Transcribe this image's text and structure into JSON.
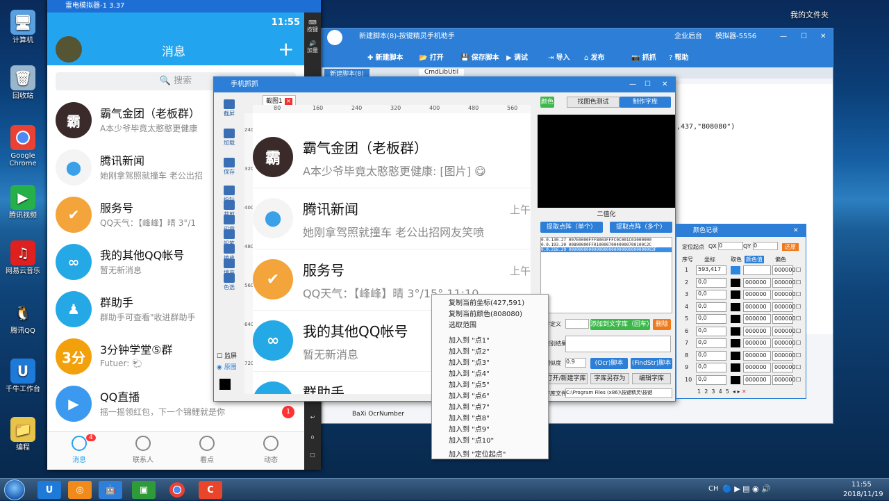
{
  "desktop": {
    "icons": [
      "计算机",
      "回收站",
      "Google Chrome",
      "腾讯视频",
      "网易云音乐",
      "腾讯QQ",
      "千牛工作台",
      "编程"
    ],
    "folder_label": "我的文件夹"
  },
  "emulator": {
    "title": "雷电模拟器-1 3.37",
    "time": "11:55",
    "header_title": "消息",
    "search_placeholder": "搜索",
    "side_labels": [
      "按键",
      "加量"
    ],
    "chats": [
      {
        "name": "霸气金团（老板群）",
        "preview": "A本少爷毕竟太憨憨更健康",
        "color": "#3a2a2a",
        "glyph": "霸"
      },
      {
        "name": "腾讯新闻",
        "preview": "她刚拿驾照就撞车 老公出招",
        "color": "#f4f4f4",
        "glyph": "⬤"
      },
      {
        "name": "服务号",
        "preview": "QQ天气：【峰峰】晴 3°/1",
        "color": "#f3a43a",
        "glyph": "✔"
      },
      {
        "name": "我的其他QQ帐号",
        "preview": "暂无新消息",
        "color": "#24a9e6",
        "glyph": "∞"
      },
      {
        "name": "群助手",
        "preview": "群助手可查看\"收进群助手",
        "color": "#24a9e6",
        "glyph": "♟"
      },
      {
        "name": "3分钟学堂⑤群",
        "preview": "Futuer: 🐑",
        "color": "#f2a10c",
        "glyph": "3分"
      },
      {
        "name": "QQ直播",
        "preview": "摇一摇领红包，下一个锦鲤就是你",
        "color": "#3b9af0",
        "glyph": "▶"
      }
    ],
    "live_badge": "1",
    "nav": [
      {
        "label": "消息",
        "badge": "4"
      },
      {
        "label": "联系人"
      },
      {
        "label": "看点"
      },
      {
        "label": "动态"
      }
    ]
  },
  "helper": {
    "title": "新建脚本(8)-按键精灵手机助手",
    "enterprise": "企业后台",
    "simulator": "模拟器-5556",
    "toolbar": [
      "新建脚本",
      "打开",
      "保存脚本",
      "调试",
      "导入",
      "发布",
      "抓抓",
      "帮助"
    ],
    "tabs": [
      "新建脚本(8)",
      "CmdLibUtil"
    ],
    "code_line": ",437,\"808080\")",
    "ocr": "BaXi OcrNumber"
  },
  "capture": {
    "title": "手机抓抓",
    "tab": "截图1",
    "tools": [
      "截屏",
      "加载",
      "保存",
      "指针",
      "裁剪",
      "印章",
      "铅笔",
      "擦皮",
      "填充",
      "色选"
    ],
    "ruler_top": [
      "80",
      "160",
      "240",
      "320",
      "400",
      "480",
      "560"
    ],
    "ruler_left": [
      "240",
      "320",
      "400",
      "480",
      "560",
      "640",
      "720"
    ],
    "chats": [
      {
        "name": "霸气金团（老板群）",
        "preview": "A本少爷毕竟太憨憨更健康: [图片] 😋",
        "time": "",
        "color": "#3a2a2a",
        "glyph": "霸"
      },
      {
        "name": "腾讯新闻",
        "preview": "她刚拿驾照就撞车 老公出招网友笑喷",
        "time": "上午",
        "color": "#f4f4f4",
        "glyph": "⬤"
      },
      {
        "name": "服务号",
        "preview": "QQ天气：【峰峰】晴 3°/15° 11:10",
        "time": "上午",
        "color": "#f3a43a",
        "glyph": "✔"
      },
      {
        "name": "我的其他QQ帐号",
        "preview": "暂无新消息",
        "time": "",
        "color": "#24a9e6",
        "glyph": "∞"
      },
      {
        "name": "群助手",
        "preview": "",
        "time": "",
        "color": "#24a9e6",
        "glyph": "♟"
      }
    ],
    "checkbox": "监屏",
    "radio": "原图",
    "right": {
      "color_btn": "颜色",
      "tab1": "找图色测试",
      "tab2": "制作字库",
      "binarize": "二值化",
      "extract_one": "提取点阵（单个）",
      "extract_many": "提取点阵（多个）",
      "dots": [
        "0.0.130.27 007E0000FFF8003FFFC0C001C03000000",
        "0.0.193.30 00800000FF01000070040000700100C2C",
        "0.0.216.29 0000000000000000000000000000000003F"
      ],
      "define": "字定义",
      "add_btn": "添加到文字库（回车）",
      "delete": "删除",
      "result": "识别结果",
      "similarity": "相似度",
      "sim_val": "0.9",
      "ocr_btn": "(Ocr)脚本",
      "find_btn": "(FindStr)脚本",
      "open_lib": "打开/新建字库",
      "save_as": "字库另存为",
      "edit_lib": "编辑字库",
      "lib_file": "字库文件",
      "lib_path": "C:\\Program Files (x86)\\按键精灵\\按键"
    }
  },
  "context_menu": [
    "复制当前坐标(427,591)",
    "复制当前颜色(808080)",
    "选取范围",
    "加入到 \"点1\"",
    "加入到 \"点2\"",
    "加入到 \"点3\"",
    "加入到 \"点4\"",
    "加入到 \"点5\"",
    "加入到 \"点6\"",
    "加入到 \"点7\"",
    "加入到 \"点8\"",
    "加入到 \"点9\"",
    "加入到 \"点10\"",
    "加入到 \"定位起点\""
  ],
  "color_record": {
    "title": "颜色记录",
    "origin": "定位起点",
    "qx": "QX",
    "qx_val": "0",
    "qy": "QY",
    "qy_val": "0",
    "reset": "还原",
    "headers": [
      "序号",
      "坐标",
      "取色",
      "颜色值",
      "偏色"
    ],
    "rows": [
      {
        "n": "1",
        "c": "593,417",
        "col": "#2a86e0",
        "v": "",
        "o": "000000"
      },
      {
        "n": "2",
        "c": "0,0",
        "col": "#000000",
        "v": "000000",
        "o": "000000"
      },
      {
        "n": "3",
        "c": "0,0",
        "col": "#000000",
        "v": "000000",
        "o": "000000"
      },
      {
        "n": "4",
        "c": "0,0",
        "col": "#000000",
        "v": "000000",
        "o": "000000"
      },
      {
        "n": "5",
        "c": "0,0",
        "col": "#000000",
        "v": "000000",
        "o": "000000"
      },
      {
        "n": "6",
        "c": "0,0",
        "col": "#000000",
        "v": "000000",
        "o": "000000"
      },
      {
        "n": "7",
        "c": "0,0",
        "col": "#000000",
        "v": "000000",
        "o": "000000"
      },
      {
        "n": "8",
        "c": "0,0",
        "col": "#000000",
        "v": "000000",
        "o": "000000"
      },
      {
        "n": "9",
        "c": "0,0",
        "col": "#000000",
        "v": "000000",
        "o": "000000"
      },
      {
        "n": "10",
        "c": "0,0",
        "col": "#000000",
        "v": "000000",
        "o": "000000"
      }
    ],
    "pages": [
      "1",
      "2",
      "3",
      "4",
      "5"
    ]
  },
  "tray": {
    "ime": "CH",
    "time": "11:55",
    "date": "2018/11/19"
  }
}
